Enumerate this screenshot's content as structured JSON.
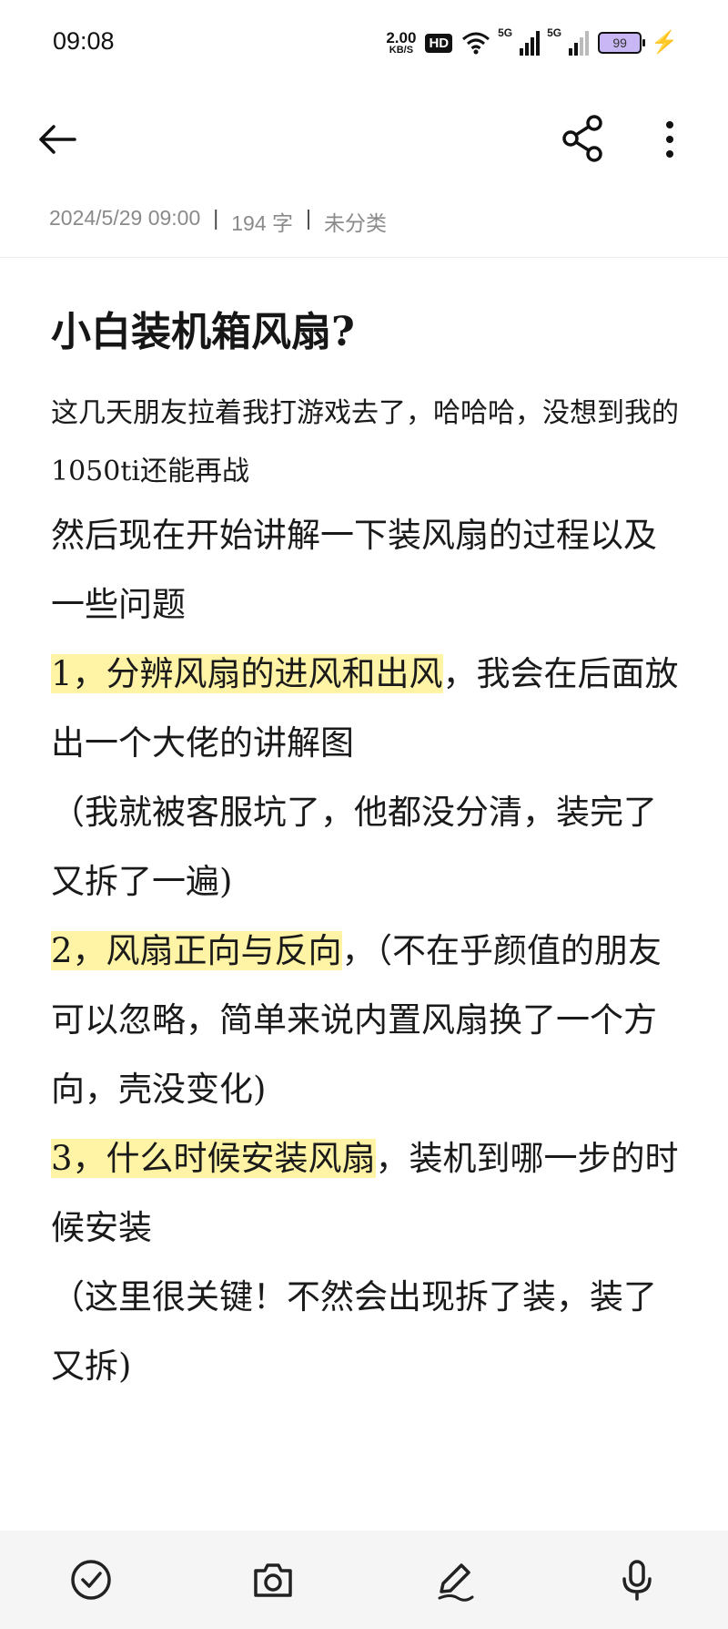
{
  "status": {
    "time": "09:08",
    "speed_value": "2.00",
    "speed_unit": "KB/S",
    "hd": "HD",
    "net1": "5G",
    "net2": "5G",
    "battery": "99"
  },
  "toolbar": {
    "back_icon": "arrow-left-icon",
    "share_icon": "share-icon",
    "more_icon": "more-vertical-icon"
  },
  "meta": {
    "date": "2024/5/29 09:00",
    "sep1": "|",
    "words": "194 字",
    "sep2": "|",
    "category": "未分类"
  },
  "note": {
    "title": "小白装机箱风扇?",
    "p1": "这几天朋友拉着我打游戏去了，哈哈哈，没想到我的1050ti还能再战",
    "p2": "然后现在开始讲解一下装风扇的过程以及一些问题",
    "p3_hl": "1，分辨风扇的进风和出风",
    "p3_rest": "，我会在后面放出一个大佬的讲解图",
    "p4": "（我就被客服坑了，他都没分清，装完了又拆了一遍)",
    "p5_hl": "2，风扇正向与反向",
    "p5_rest": "，（不在乎颜值的朋友可以忽略，简单来说内置风扇换了一个方向，壳没变化)",
    "p6_hl": "3，什么时候安装风扇",
    "p6_rest": "，装机到哪一步的时候安装",
    "p7": "（这里很关键！不然会出现拆了装，装了又拆)"
  },
  "bottom_bar": {
    "icons": [
      "checklist-icon",
      "camera-icon",
      "pen-icon",
      "microphone-icon"
    ]
  },
  "colors": {
    "highlight": "#fff3a6",
    "battery_fill": "#c9b6f5",
    "charging": "#8e55e8",
    "meta_text": "#8a8a8a"
  }
}
